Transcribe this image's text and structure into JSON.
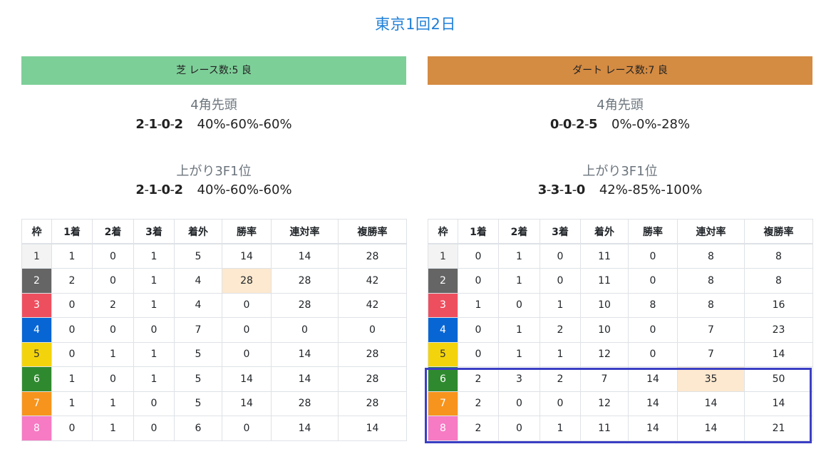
{
  "title": "東京1回2日",
  "panels": [
    {
      "header": "芝 レース数:5 良",
      "header_color": "#7dcf98",
      "corner": {
        "label": "4角先頭",
        "counts": [
          "2",
          "1",
          "0",
          "2"
        ],
        "rates": "40%-60%-60%"
      },
      "last3f": {
        "label": "上がり3F1位",
        "counts": [
          "2",
          "1",
          "0",
          "2"
        ],
        "rates": "40%-60%-60%"
      },
      "columns": [
        "枠",
        "1着",
        "2着",
        "3着",
        "着外",
        "勝率",
        "連対率",
        "複勝率"
      ],
      "rows": [
        [
          "1",
          "1",
          "0",
          "1",
          "5",
          "14",
          "14",
          "28"
        ],
        [
          "2",
          "2",
          "0",
          "1",
          "4",
          "28",
          "28",
          "42"
        ],
        [
          "3",
          "0",
          "2",
          "1",
          "4",
          "0",
          "28",
          "42"
        ],
        [
          "4",
          "0",
          "0",
          "0",
          "7",
          "0",
          "0",
          "0"
        ],
        [
          "5",
          "0",
          "1",
          "1",
          "5",
          "0",
          "14",
          "28"
        ],
        [
          "6",
          "1",
          "0",
          "1",
          "5",
          "14",
          "14",
          "28"
        ],
        [
          "7",
          "1",
          "1",
          "0",
          "5",
          "14",
          "28",
          "28"
        ],
        [
          "8",
          "0",
          "1",
          "0",
          "6",
          "0",
          "14",
          "14"
        ]
      ],
      "highlight_cell": {
        "row": 1,
        "col": 5
      }
    },
    {
      "header": "ダート レース数:7 良",
      "header_color": "#d48b42",
      "corner": {
        "label": "4角先頭",
        "counts": [
          "0",
          "0",
          "2",
          "5"
        ],
        "rates": "0%-0%-28%"
      },
      "last3f": {
        "label": "上がり3F1位",
        "counts": [
          "3",
          "3",
          "1",
          "0"
        ],
        "rates": "42%-85%-100%"
      },
      "columns": [
        "枠",
        "1着",
        "2着",
        "3着",
        "着外",
        "勝率",
        "連対率",
        "複勝率"
      ],
      "rows": [
        [
          "1",
          "0",
          "1",
          "0",
          "11",
          "0",
          "8",
          "8"
        ],
        [
          "2",
          "0",
          "1",
          "0",
          "11",
          "0",
          "8",
          "8"
        ],
        [
          "3",
          "1",
          "0",
          "1",
          "10",
          "8",
          "8",
          "16"
        ],
        [
          "4",
          "0",
          "1",
          "2",
          "10",
          "0",
          "7",
          "23"
        ],
        [
          "5",
          "0",
          "1",
          "1",
          "12",
          "0",
          "7",
          "14"
        ],
        [
          "6",
          "2",
          "3",
          "2",
          "7",
          "14",
          "35",
          "50"
        ],
        [
          "7",
          "2",
          "0",
          "0",
          "12",
          "14",
          "14",
          "14"
        ],
        [
          "8",
          "2",
          "0",
          "1",
          "11",
          "14",
          "14",
          "21"
        ]
      ],
      "highlight_cell": {
        "row": 5,
        "col": 6
      }
    }
  ],
  "frame_colors": {
    "1": {
      "bg": "#f3f3f3",
      "fg": "#333333"
    },
    "2": {
      "bg": "#656565",
      "fg": "#ffffff"
    },
    "3": {
      "bg": "#ee4f5f",
      "fg": "#ffffff"
    },
    "4": {
      "bg": "#0866d4",
      "fg": "#ffffff"
    },
    "5": {
      "bg": "#f3d40c",
      "fg": "#333333"
    },
    "6": {
      "bg": "#2f8a2f",
      "fg": "#ffffff"
    },
    "7": {
      "bg": "#f7941d",
      "fg": "#ffffff"
    },
    "8": {
      "bg": "#f77ac4",
      "fg": "#ffffff"
    }
  },
  "highlight_cell_color": "#fde9cf",
  "annotation_box_color": "#3b3fc4"
}
